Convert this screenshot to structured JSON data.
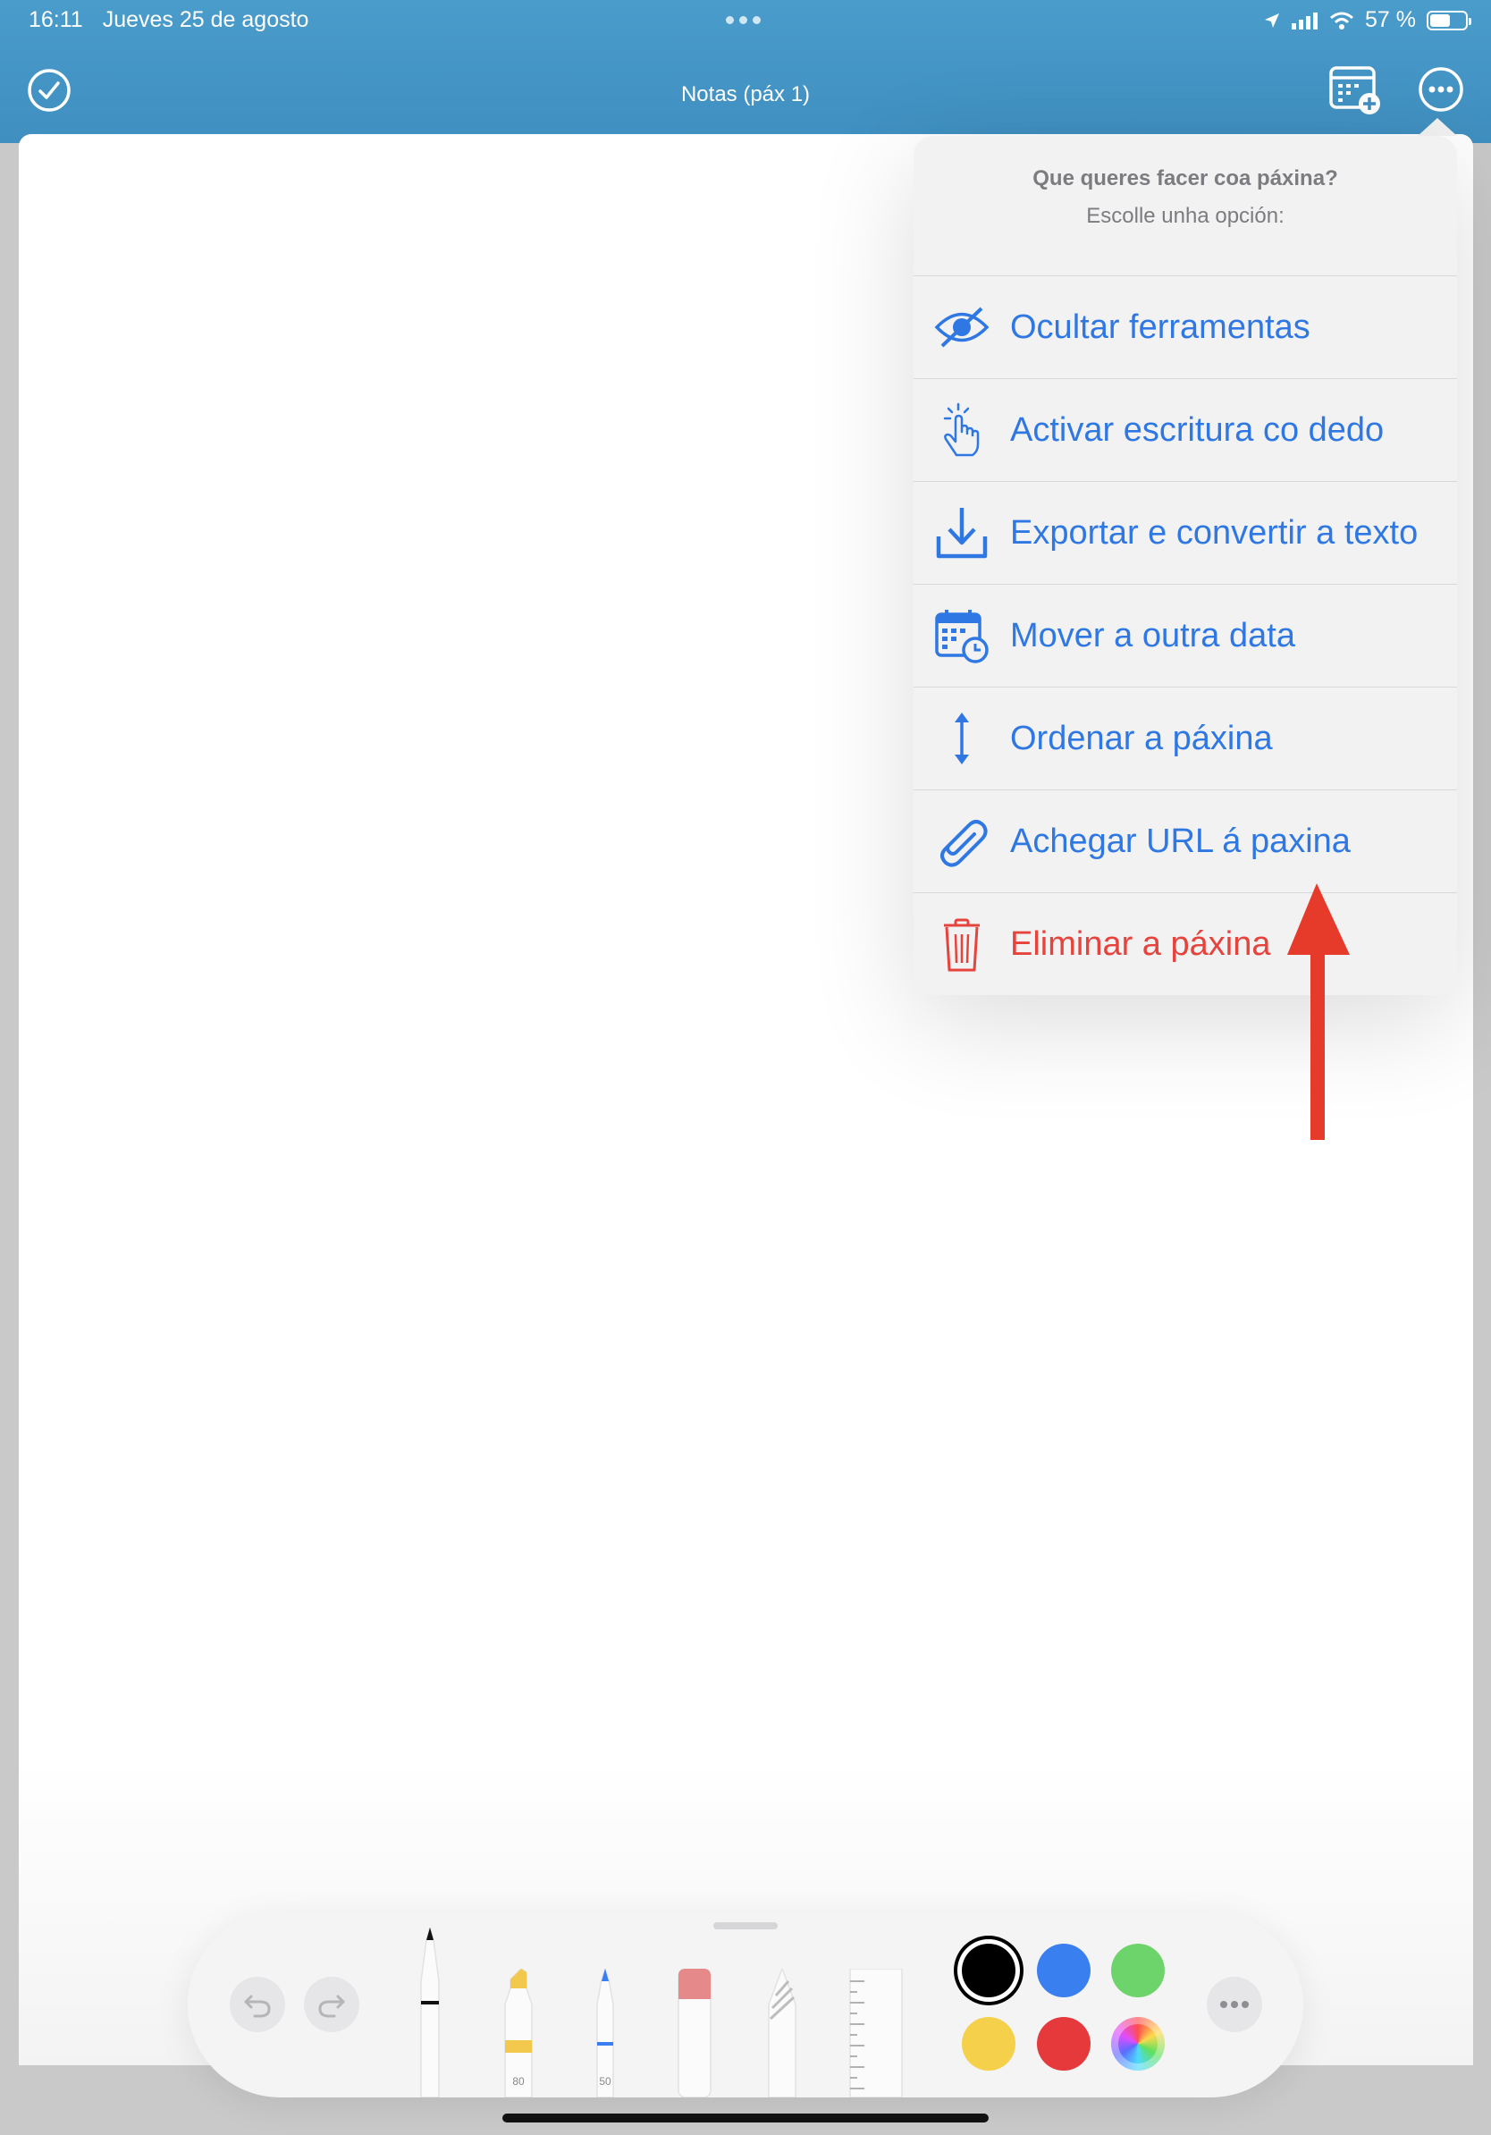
{
  "status_bar": {
    "time": "16:11",
    "date": "Jueves 25 de agosto",
    "battery": "57 %",
    "battery_level": 0.57
  },
  "nav": {
    "title": "Notas (páx 1)",
    "done_icon": "checkmark-circle-icon",
    "calendar_icon": "calendar-add-icon",
    "more_icon": "ellipsis-circle-icon"
  },
  "popover": {
    "title": "Que queres facer coa páxina?",
    "subtitle": "Escolle unha opción:",
    "items": [
      {
        "label": "Ocultar ferramentas",
        "icon": "eye-slash-icon"
      },
      {
        "label": "Activar escritura co dedo",
        "icon": "hand-tap-icon"
      },
      {
        "label": "Exportar e convertir a texto",
        "icon": "download-icon"
      },
      {
        "label": "Mover a outra data",
        "icon": "calendar-clock-icon"
      },
      {
        "label": "Ordenar a páxina",
        "icon": "vertical-arrows-icon"
      },
      {
        "label": "Achegar URL á paxina",
        "icon": "paperclip-icon"
      },
      {
        "label": "Eliminar a páxina",
        "icon": "trash-icon"
      }
    ]
  },
  "toolbar": {
    "marker_width": "80",
    "pen_width": "50",
    "colors": [
      "#000000",
      "#3a7ff0",
      "#6dd36b",
      "#f5d04a",
      "#e5393b",
      "color-wheel"
    ]
  },
  "colors": {
    "accent": "#2f78e4",
    "danger": "#e5433c",
    "header": "#4a9ccb"
  }
}
